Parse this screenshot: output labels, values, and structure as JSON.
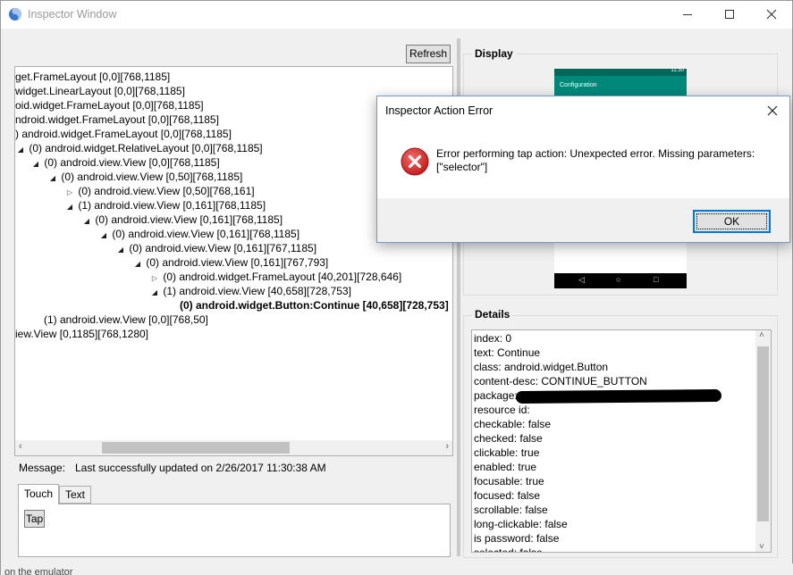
{
  "window": {
    "title": "Inspector Window",
    "controls": {
      "minimize": "minimize-icon",
      "maximize": "maximize-icon",
      "close": "close-icon"
    }
  },
  "toolbar": {
    "refresh_label": "Refresh"
  },
  "tree": {
    "rows": [
      {
        "text": "get.FrameLayout [0,0][768,1185]",
        "arrow": ""
      },
      {
        "text": "widget.LinearLayout [0,0][768,1185]",
        "arrow": ""
      },
      {
        "text": "oid.widget.FrameLayout [0,0][768,1185]",
        "arrow": ""
      },
      {
        "text": "ndroid.widget.FrameLayout [0,0][768,1185]",
        "arrow": ""
      },
      {
        "text": ") android.widget.FrameLayout [0,0][768,1185]",
        "arrow": ""
      },
      {
        "text": "(0) android.widget.RelativeLayout [0,0][768,1185]",
        "arrow": "◢"
      },
      {
        "text": "(0) android.view.View [0,0][768,1185]",
        "arrow": "◢"
      },
      {
        "text": "(0) android.view.View [0,50][768,1185]",
        "arrow": "◢"
      },
      {
        "text": "(0) android.view.View [0,50][768,161]",
        "arrow": "▷"
      },
      {
        "text": "(1) android.view.View [0,161][768,1185]",
        "arrow": "◢"
      },
      {
        "text": "(0) android.view.View [0,161][768,1185]",
        "arrow": "◢"
      },
      {
        "text": "(0) android.view.View [0,161][768,1185]",
        "arrow": "◢"
      },
      {
        "text": "(0) android.view.View [0,161][767,1185]",
        "arrow": "◢"
      },
      {
        "text": "(0) android.view.View [0,161][767,793]",
        "arrow": "◢"
      },
      {
        "text": "(0) android.widget.FrameLayout [40,201][728,646]",
        "arrow": "▷"
      },
      {
        "text": "(1) android.view.View [40,658][728,753]",
        "arrow": "◢"
      },
      {
        "text": "(0) android.widget.Button:Continue [40,658][728,753]",
        "arrow": ""
      },
      {
        "text": "(1) android.view.View [0,0][768,50]",
        "arrow": ""
      },
      {
        "text": "iew.View [0,1185][768,1280]",
        "arrow": ""
      }
    ]
  },
  "message": {
    "label": "Message:",
    "text": "Last successfully updated on 2/26/2017 11:30:38 AM"
  },
  "tabs": [
    {
      "label": "Touch",
      "active": true
    },
    {
      "label": "Text",
      "active": false
    }
  ],
  "touch_panel": {
    "tap_label": "Tap"
  },
  "display": {
    "title": "Display",
    "device": {
      "clock": "11:30",
      "app_title": "Configuration",
      "nav_back": "◁",
      "nav_home": "○",
      "nav_recent": "□"
    }
  },
  "details": {
    "title": "Details",
    "lines": [
      "index: 0",
      "text: Continue",
      "class: android.widget.Button",
      "content-desc: CONTINUE_BUTTON",
      "package:",
      "resource id:",
      "checkable: false",
      "checked: false",
      "clickable: true",
      "enabled: true",
      "focusable: true",
      "focused: false",
      "scrollable: false",
      "long-clickable: false",
      "is password: false",
      "selected: false"
    ]
  },
  "background_text": "on the emulator",
  "dialog": {
    "title": "Inspector Action Error",
    "message": "Error performing tap action: Unexpected error. Missing parameters: [\"selector\"]",
    "ok_label": "OK",
    "icon": "error-icon"
  },
  "colors": {
    "accent": "#0078d7",
    "error_red": "#d32f2f",
    "device_appbar": "#00897b",
    "device_statusbar": "#00695c"
  }
}
